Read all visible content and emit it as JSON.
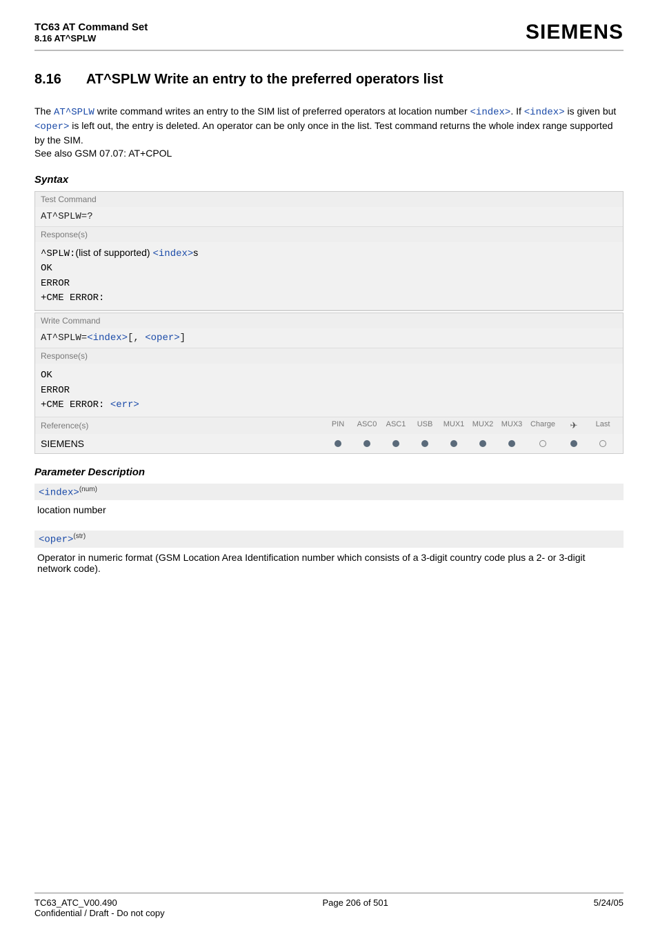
{
  "header": {
    "title": "TC63 AT Command Set",
    "subtitle": "8.16 AT^SPLW",
    "brand": "SIEMENS"
  },
  "section": {
    "number": "8.16",
    "title": "AT^SPLW   Write an entry to the preferred operators list"
  },
  "intro": {
    "p1a": "The ",
    "p1_link1": "AT^SPLW",
    "p1b": " write command writes an entry to the SIM list of preferred operators at location number ",
    "p1_link2": "<index>",
    "p1c": ". If ",
    "p1_link3": "<index>",
    "p1d": " is given but ",
    "p1_link4": "<oper>",
    "p1e": " is left out, the entry is deleted. An operator can be only once in the list. Test command returns the whole index range supported by the SIM.",
    "p2": "See also GSM 07.07: AT+CPOL"
  },
  "syntax": {
    "heading": "Syntax",
    "test_label": "Test Command",
    "test_cmd": "AT^SPLW=?",
    "resp_label": "Response(s)",
    "test_resp_prefix": "^SPLW:",
    "test_resp_mid": "(list of supported) ",
    "test_resp_link": "<index>",
    "test_resp_suffix": "s",
    "ok": "OK",
    "error": "ERROR",
    "cme": "+CME ERROR:",
    "write_label": "Write Command",
    "write_cmd_a": "AT^SPLW=",
    "write_cmd_link1": "<index>",
    "write_cmd_b": "[, ",
    "write_cmd_link2": "<oper>",
    "write_cmd_c": "]",
    "write_resp_cme": "+CME ERROR: ",
    "write_resp_err": "<err>",
    "ref_label": "Reference(s)",
    "ref_value": "SIEMENS",
    "cols": {
      "pin": "PIN",
      "asc0": "ASC0",
      "asc1": "ASC1",
      "usb": "USB",
      "mux1": "MUX1",
      "mux2": "MUX2",
      "mux3": "MUX3",
      "charge": "Charge",
      "air": "✈",
      "last": "Last"
    }
  },
  "params": {
    "heading": "Parameter Description",
    "index_name": "<index>",
    "index_type": "(num)",
    "index_desc": "location number",
    "oper_name": "<oper>",
    "oper_type": "(str)",
    "oper_desc": "Operator in numeric format (GSM Location Area Identification number which consists of a 3-digit country code plus a 2- or 3-digit network code)."
  },
  "footer": {
    "left": "TC63_ATC_V00.490",
    "center": "Page 206 of 501",
    "right": "5/24/05",
    "sub": "Confidential / Draft - Do not copy"
  }
}
